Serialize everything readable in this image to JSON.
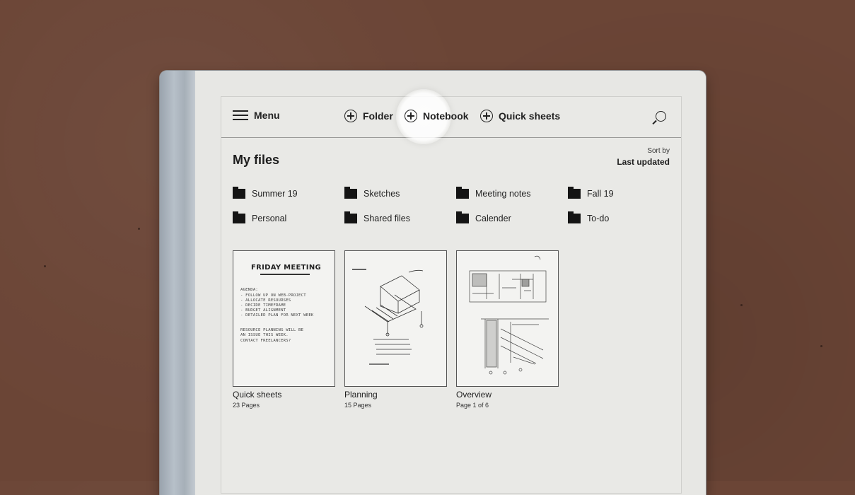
{
  "toolbar": {
    "menu_label": "Menu",
    "folder_label": "Folder",
    "notebook_label": "Notebook",
    "quick_sheets_label": "Quick sheets"
  },
  "header": {
    "title": "My files",
    "sort_label": "Sort by",
    "sort_value": "Last updated"
  },
  "folders": [
    {
      "name": "Summer 19"
    },
    {
      "name": "Sketches"
    },
    {
      "name": "Meeting notes"
    },
    {
      "name": "Fall 19"
    },
    {
      "name": "Personal"
    },
    {
      "name": "Shared files"
    },
    {
      "name": "Calender"
    },
    {
      "name": "To-do"
    }
  ],
  "notebooks": [
    {
      "title": "Quick sheets",
      "subtitle": "23 Pages",
      "preview": {
        "heading": "FRIDAY MEETING",
        "lines": [
          "AGENDA:",
          "- FOLLOW UP ON WEB-PROJECT",
          "- ALLOCATE RESOURSES",
          "- DECIDE TIMEFRAME",
          "- BUDGET ALIGNMENT",
          "- DETAILED PLAN FOR NEXT WEEK",
          "",
          "RESOURCE PLANNING WILL BE",
          "AN ISSUE THIS WEEK.",
          "CONTACT FREELANCERS?"
        ]
      }
    },
    {
      "title": "Planning",
      "subtitle": "15 Pages"
    },
    {
      "title": "Overview",
      "subtitle": "Page 1 of 6"
    }
  ]
}
